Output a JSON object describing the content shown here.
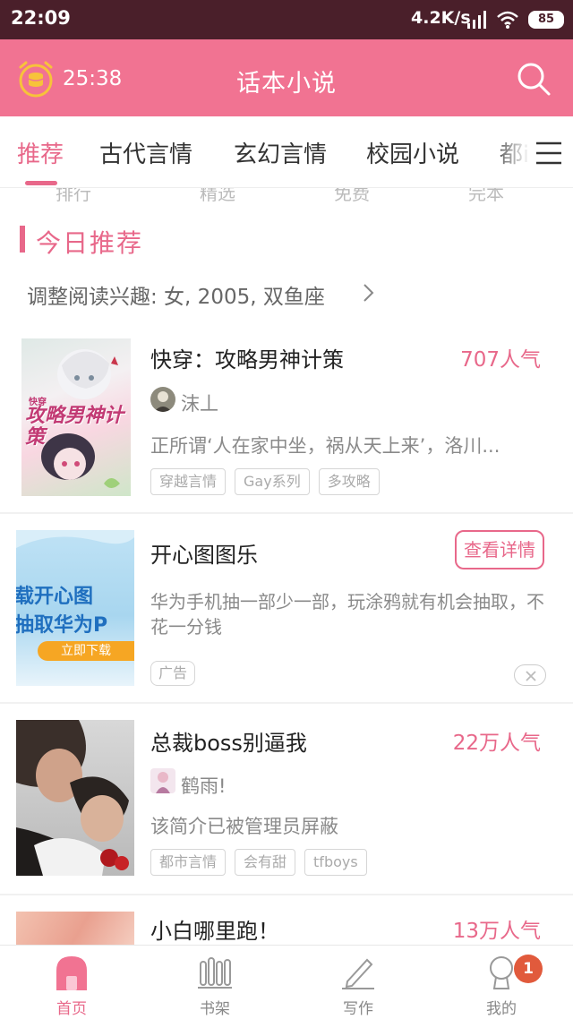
{
  "status_bar": {
    "time": "22:09",
    "network_speed": "4.2K/s",
    "battery": "85"
  },
  "header": {
    "timer": "25:38",
    "title": "话本小说",
    "icons": {
      "left": "alarm-timer-icon",
      "right": "search-icon"
    }
  },
  "tabs": {
    "items": [
      {
        "label": "推荐",
        "active": true
      },
      {
        "label": "古代言情",
        "active": false
      },
      {
        "label": "玄幻言情",
        "active": false
      },
      {
        "label": "校园小说",
        "active": false
      },
      {
        "label": "都i",
        "active": false
      }
    ],
    "menu_icon": "menu-icon"
  },
  "shortcut_peek": [
    "排行",
    "精选",
    "免费",
    "完本"
  ],
  "section": {
    "title": "今日推荐",
    "interest": "调整阅读兴趣: 女, 2005, 双鱼座"
  },
  "books": [
    {
      "title": "快穿：攻略男神计策",
      "popularity": "707人气",
      "author": "沫丄",
      "synopsis": "正所谓‘人在家中坐，祸从天上来’，洛川...",
      "tags": [
        "穿越言情",
        "Gay系列",
        "多攻略"
      ],
      "cover_text": "攻略男神计策",
      "cover_small": "快穿"
    },
    {
      "title": "总裁boss别逼我",
      "popularity": "22万人气",
      "author": "鹤雨!",
      "synopsis": "该简介已被管理员屏蔽",
      "tags": [
        "都市言情",
        "会有甜",
        "tfboys"
      ]
    },
    {
      "title": "小白哪里跑！",
      "popularity": "13万人气"
    }
  ],
  "ad": {
    "title": "开心图图乐",
    "button": "查看详情",
    "description": "华为手机抽一部少一部，玩涂鸦就有机会抽取，不花一分钱",
    "tag": "广告",
    "banner_line1": "载开心图",
    "banner_line2": "抽取华为P",
    "banner_button": "立即下载"
  },
  "bottom_nav": [
    {
      "label": "首页",
      "icon": "home-icon",
      "active": true
    },
    {
      "label": "书架",
      "icon": "bookshelf-icon",
      "active": false
    },
    {
      "label": "写作",
      "icon": "pen-icon",
      "active": false
    },
    {
      "label": "我的",
      "icon": "profile-icon",
      "active": false,
      "badge": "1"
    }
  ],
  "colors": {
    "brand": "#f17392",
    "accent": "#e8688a",
    "status_bar": "#4a1f2a",
    "badge": "#e15a3c"
  }
}
